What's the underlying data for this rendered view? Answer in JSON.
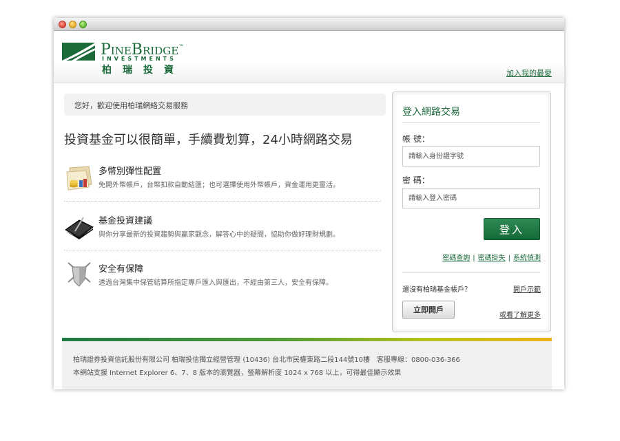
{
  "header": {
    "logo": {
      "name": "PineBridge",
      "tm": "™",
      "sub": "INVESTMENTS",
      "cn": "柏瑞投資"
    },
    "favorite_link": "加入我的最愛"
  },
  "main": {
    "welcome": "您好，歡迎使用柏瑞網絡交易服務",
    "headline": "投資基金可以很簡單，手續費划算，24小時網路交易",
    "features": [
      {
        "icon": "coins-folder-icon",
        "title": "多幣別彈性配置",
        "desc": "免開外幣帳戶，台幣扣款自動結匯；也可選擇使用外幣帳戶，資金運用更靈活。"
      },
      {
        "icon": "notebook-pen-icon",
        "title": "基金投資建議",
        "desc": "與你分享最新的投資趨勢與贏家觀念，解答心中的疑問，協助你做好理財規劃。"
      },
      {
        "icon": "shield-swords-icon",
        "title": "安全有保障",
        "desc": "透過台灣集中保管結算所指定專戶匯入與匯出，不經由第三人，安全有保障。"
      }
    ]
  },
  "login": {
    "title": "登入網路交易",
    "account_label": "帳 號：",
    "account_placeholder": "請輸入身份證字號",
    "password_label": "密 碼：",
    "password_placeholder": "請輸入登入密碼",
    "login_button": "登入",
    "links": [
      "密碼查詢",
      "密碼掛失",
      "系統偵測"
    ],
    "separator": "|",
    "no_account": "還沒有柏瑞基金帳戶？",
    "demo_link": "開戶示範",
    "open_button": "立即開戶",
    "more_link": "或看了解更多"
  },
  "footer": {
    "line1": "柏瑞證券投資信託股份有限公司 柏瑞投信獨立經營管理 (10436) 台北市民權東路二段144號10樓　客服專線：0800-036-366",
    "line2": "本網站支援 Internet Explorer 6、7、8 版本的瀏覽器，螢幕解析度 1024 x 768 以上，可得最佳顯示效果"
  },
  "colors": {
    "brand_green": "#1d6a3c",
    "login_button": "#1f7a45",
    "footer_gradient_end": "#f0b21a"
  }
}
